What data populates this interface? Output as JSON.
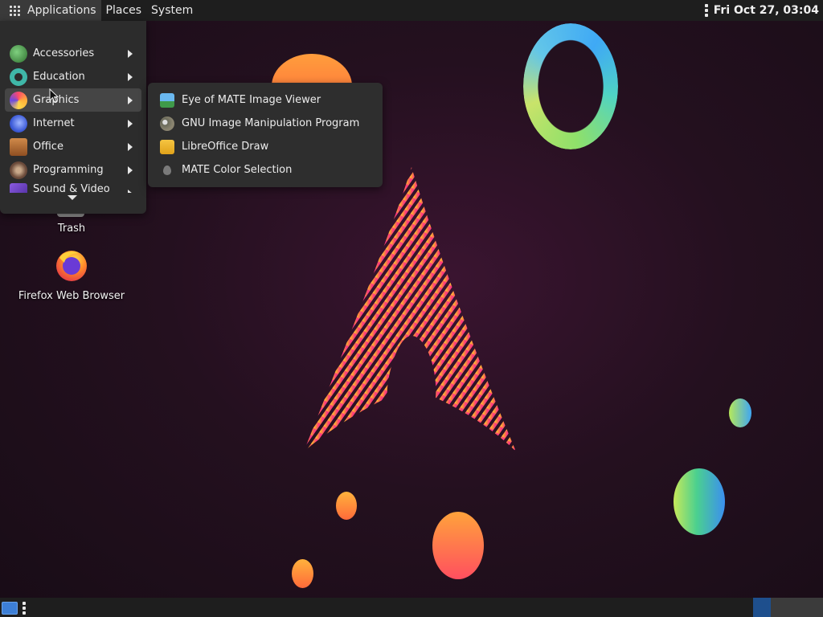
{
  "top_panel": {
    "applications_label": "Applications",
    "places_label": "Places",
    "system_label": "System",
    "clock": "Fri Oct 27, 03:04"
  },
  "desktop": {
    "icons": [
      {
        "label": "Trash",
        "icon": "trash-icon"
      },
      {
        "label": "Firefox Web Browser",
        "icon": "firefox-icon"
      }
    ]
  },
  "applications_menu": {
    "items": [
      {
        "label": "Accessories",
        "icon": "accessories-icon",
        "color": "#3a8f3a"
      },
      {
        "label": "Education",
        "icon": "education-icon",
        "color": "#3fb7a8"
      },
      {
        "label": "Graphics",
        "icon": "graphics-icon",
        "color": "#e0644a",
        "highlighted": true
      },
      {
        "label": "Internet",
        "icon": "internet-icon",
        "color": "#3d5bd8"
      },
      {
        "label": "Office",
        "icon": "office-icon",
        "color": "#b86a2e"
      },
      {
        "label": "Programming",
        "icon": "programming-icon",
        "color": "#7a5a4a"
      },
      {
        "label": "Sound & Video",
        "icon": "sound-video-icon",
        "color": "#6a3fb0"
      }
    ]
  },
  "graphics_submenu": {
    "items": [
      {
        "label": "Eye of MATE Image Viewer",
        "icon": "image-viewer-icon"
      },
      {
        "label": "GNU Image Manipulation Program",
        "icon": "gimp-icon"
      },
      {
        "label": "LibreOffice Draw",
        "icon": "libreoffice-draw-icon"
      },
      {
        "label": "MATE Color Selection",
        "icon": "color-selection-icon"
      }
    ]
  },
  "bottom_panel": {
    "workspaces": [
      {
        "name": "workspace-1",
        "active": true
      },
      {
        "name": "workspace-2",
        "active": false
      }
    ]
  }
}
